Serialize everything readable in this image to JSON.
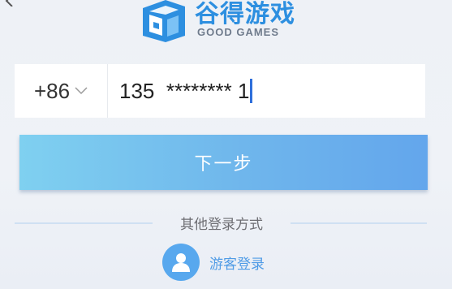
{
  "brand": {
    "name_cn": "谷得游戏",
    "name_en": "GOOD GAMES",
    "color": "#2d8fe0"
  },
  "phone": {
    "country_code": "+86",
    "value": "135  ******** 1"
  },
  "next_button": {
    "label": "下一步"
  },
  "other_methods": {
    "label": "其他登录方式"
  },
  "guest_login": {
    "label": "游客登录",
    "icon": "user-icon"
  },
  "colors": {
    "accent": "#58a8ee",
    "button_start": "#7fd0f0",
    "button_end": "#63a6ec",
    "caret": "#2f6fdb"
  }
}
